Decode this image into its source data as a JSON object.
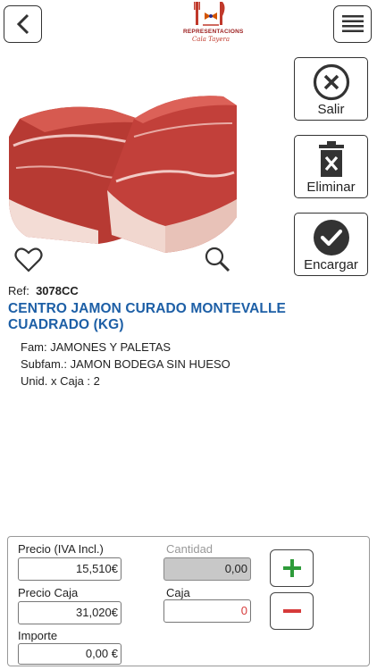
{
  "header": {
    "logo_line1": "REPRESENTACIONS",
    "logo_line2": "Cala Tayera"
  },
  "actions": {
    "salir": "Salir",
    "eliminar": "Eliminar",
    "encargar": "Encargar"
  },
  "product": {
    "ref_label": "Ref:",
    "ref_value": "3078CC",
    "title": "CENTRO JAMON CURADO MONTEVALLE CUADRADO (KG)",
    "fam": "Fam:  JAMONES Y PALETAS",
    "subfam": "Subfam.: JAMON BODEGA SIN HUESO",
    "unid": "Unid. x Caja :  2"
  },
  "calc": {
    "precio_label": "Precio (IVA Incl.)",
    "precio_value": "15,510€",
    "cantidad_label": "Cantidad",
    "cantidad_value": "0,00",
    "precio_caja_label": "Precio Caja",
    "precio_caja_value": "31,020€",
    "caja_label": "Caja",
    "caja_value": "0",
    "importe_label": "Importe",
    "importe_value": "0,00 €"
  },
  "colors": {
    "title_blue": "#1d5fa6",
    "plus_green": "#2e9b3a",
    "minus_red": "#d63a3a"
  }
}
